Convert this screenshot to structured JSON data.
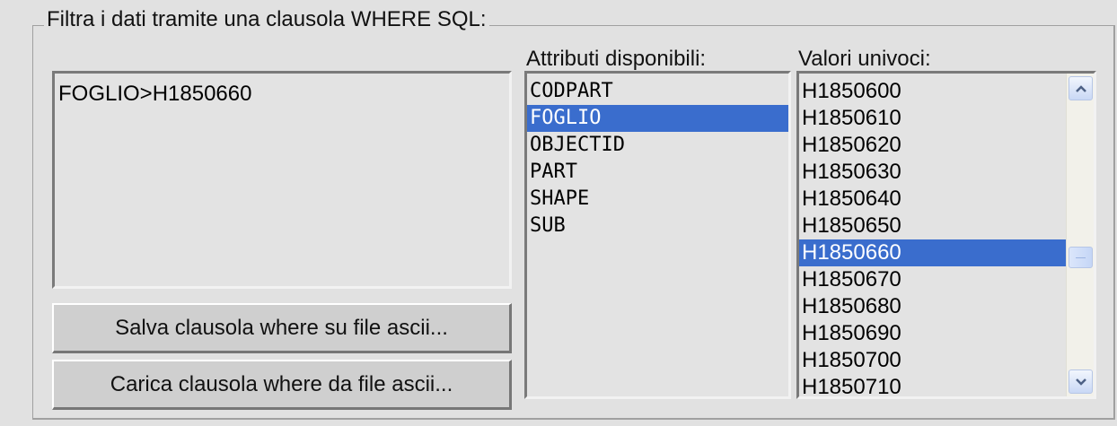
{
  "group": {
    "title": "Filtra i dati tramite una clausola WHERE SQL:"
  },
  "where_clause": {
    "value": "FOGLIO>H1850660"
  },
  "buttons": {
    "save_label": "Salva clausola where su file ascii...",
    "load_label": "Carica clausola where da file ascii..."
  },
  "attributes": {
    "label": "Attributi disponibili:",
    "items": [
      "CODPART",
      "FOGLIO",
      "OBJECTID",
      "PART",
      "SHAPE",
      "SUB"
    ],
    "selected": "FOGLIO"
  },
  "unique_values": {
    "label": "Valori univoci:",
    "items": [
      "H1850600",
      "H1850610",
      "H1850620",
      "H1850630",
      "H1850640",
      "H1850650",
      "H1850660",
      "H1850670",
      "H1850680",
      "H1850690",
      "H1850700",
      "H1850710"
    ],
    "selected": "H1850660"
  },
  "scrollbar": {
    "up_icon": "chevron-up-icon",
    "down_icon": "chevron-down-icon"
  },
  "colors": {
    "selection": "#3a6dcd",
    "background": "#e1e1e1"
  }
}
